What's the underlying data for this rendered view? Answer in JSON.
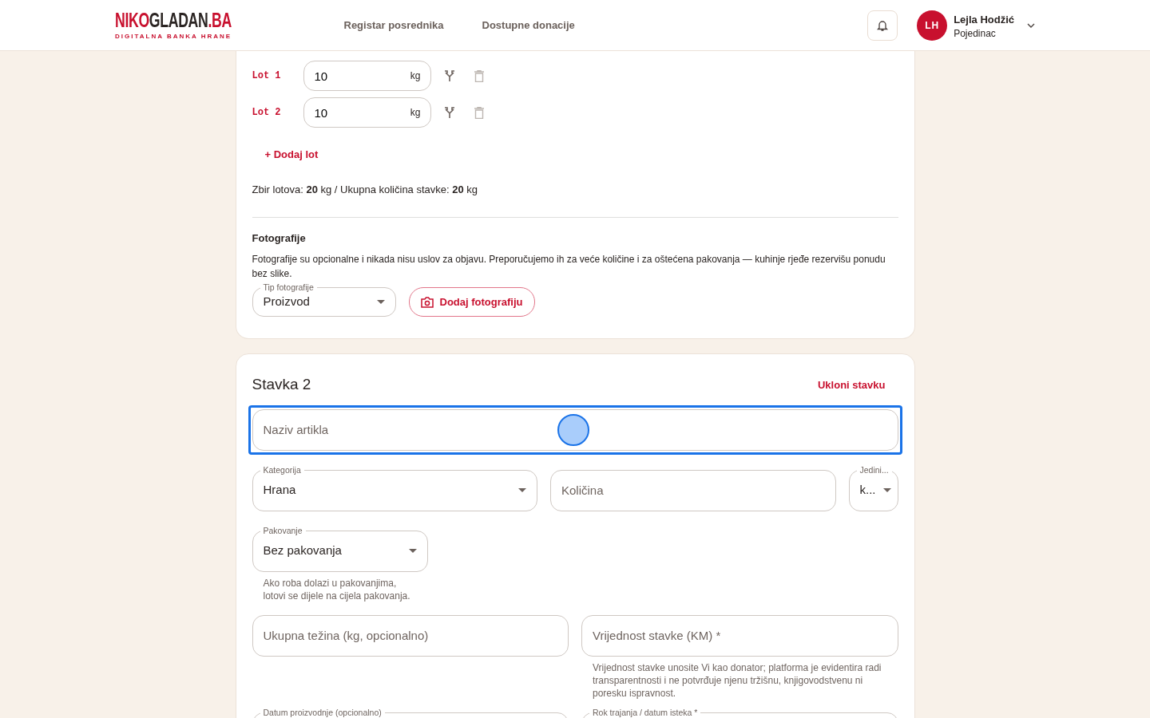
{
  "header": {
    "logo": {
      "part_red": "NIKO",
      "part_dark": "GLADAN",
      "part_suffix": ".BA",
      "tagline": "DIGITALNA BANKA HRANE"
    },
    "nav": [
      {
        "label": "Registar posrednika"
      },
      {
        "label": "Dostupne donacije"
      }
    ],
    "user": {
      "initials": "LH",
      "name": "Lejla Hodžić",
      "role": "Pojedinac"
    }
  },
  "item_1": {
    "lots": [
      {
        "label": "Lot 1",
        "value": "10",
        "unit": "kg"
      },
      {
        "label": "Lot 2",
        "value": "10",
        "unit": "kg"
      }
    ],
    "add_lot": "+ Dodaj lot",
    "summary": "Zbir lotova: **20** kg / Ukupna količina stavke: **20** kg",
    "photos": {
      "title": "Fotografije",
      "description": "Fotografije su opcionalne i nikada nisu uslov za objavu. Preporučujemo ih za veće količine i za oštećena pakovanja — kuhinje rjeđe rezervišu ponudu bez slike.",
      "type_select": {
        "label": "Tip fotografije",
        "value": "Proizvod"
      },
      "add_button": "Dodaj fotografiju"
    }
  },
  "item_2": {
    "title": "Stavka 2",
    "remove": "Ukloni stavku",
    "rows": [
      [
        {
          "kind": "text",
          "placeholder": "Naziv artikla",
          "focused": true
        }
      ],
      [
        {
          "kind": "select",
          "label": "Kategorija",
          "value": "Hrana",
          "focused": false
        },
        {
          "kind": "text",
          "placeholder": "Količina",
          "focused": false
        },
        {
          "kind": "compact-select",
          "label": "Jedini...",
          "value": "k...",
          "focused": false
        }
      ],
      [
        {
          "kind": "select",
          "label": "Pakovanje",
          "value": "Bez pakovanja",
          "helper": "Ako roba dolazi u pakovanjima,\nlotovi se dijele na cijela pakovanja.",
          "focused": false
        }
      ],
      [
        {
          "kind": "text",
          "placeholder": "Ukupna težina (kg, opcionalno)",
          "focused": false
        },
        {
          "kind": "text",
          "placeholder": "Vrijednost stavke (KM) *",
          "helper": "Vrijednost stavke unosite Vi kao donator; platforma je evidentira radi transparentnosti i ne potvrđuje njenu tržišnu, knjigovodstvenu ni poresku ispravnost.",
          "focused": false
        }
      ],
      [
        {
          "kind": "date",
          "label": "Datum proizvodnje (opcionalno)"
        },
        {
          "kind": "date",
          "label": "Rok trajanja / datum isteka *"
        }
      ]
    ]
  }
}
